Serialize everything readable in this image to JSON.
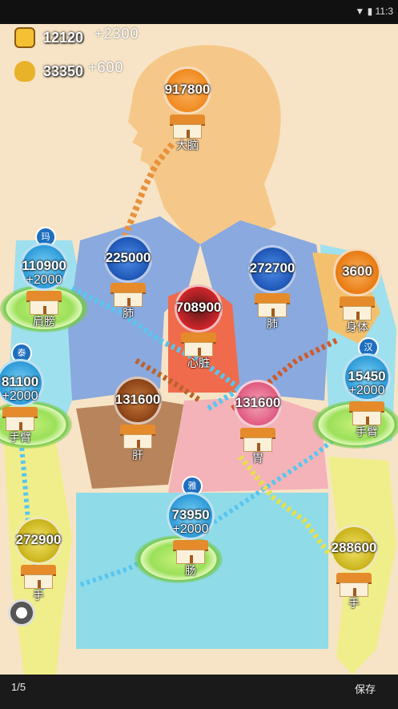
{
  "resources": {
    "coins": {
      "value": "12120",
      "increment": "+2300"
    },
    "grain": {
      "value": "33350",
      "increment": "+600"
    }
  },
  "nodes": [
    {
      "id": "head",
      "value": "917800",
      "label": "大脑",
      "color": "#f08a1e"
    },
    {
      "id": "lung-left",
      "value": "225000",
      "label": "肺",
      "color": "#2b6fd6"
    },
    {
      "id": "lung-right",
      "value": "272700",
      "label": "肺",
      "color": "#2b6fd6"
    },
    {
      "id": "body",
      "value": "3600",
      "label": "身体",
      "color": "#f08a1e"
    },
    {
      "id": "heart",
      "value": "708900",
      "label": "心脏",
      "color": "#d2252a"
    },
    {
      "id": "shoulder-left",
      "value": "110900",
      "plus": "+2000",
      "tag": "玛",
      "label": "肩膀",
      "color": "#3fb0e8"
    },
    {
      "id": "arm-left",
      "value": "81100",
      "plus": "+2000",
      "tag": "泰",
      "label": "手臂",
      "color": "#3fb0e8"
    },
    {
      "id": "arm-right",
      "value": "15450",
      "plus": "+2000",
      "tag": "汉",
      "label": "手臂",
      "color": "#3fb0e8"
    },
    {
      "id": "liver",
      "value": "131600",
      "label": "肝",
      "color": "#a0521f"
    },
    {
      "id": "stomach",
      "value": "131600",
      "label": "胃",
      "color": "#e86a8c"
    },
    {
      "id": "intestine",
      "value": "73950",
      "plus": "+2000",
      "tag": "雅",
      "label": "肠",
      "color": "#3fb0e8"
    },
    {
      "id": "hand-left",
      "value": "272900",
      "label": "手",
      "color": "#d7c324"
    },
    {
      "id": "hand-right",
      "value": "288600",
      "label": "手",
      "color": "#d7c324"
    }
  ],
  "footer": {
    "page": "1/5",
    "save_label": "保存"
  },
  "status_bar": {
    "time": "11:3"
  },
  "colors": {
    "lung": "#8aa9de",
    "stomach_region": "#f4b3b8",
    "liver_region": "#b8845c",
    "heart_region": "#f06b4c",
    "arm": "#f0ee8a",
    "intestine": "#8fdbe8",
    "head": "#f5c88a"
  }
}
